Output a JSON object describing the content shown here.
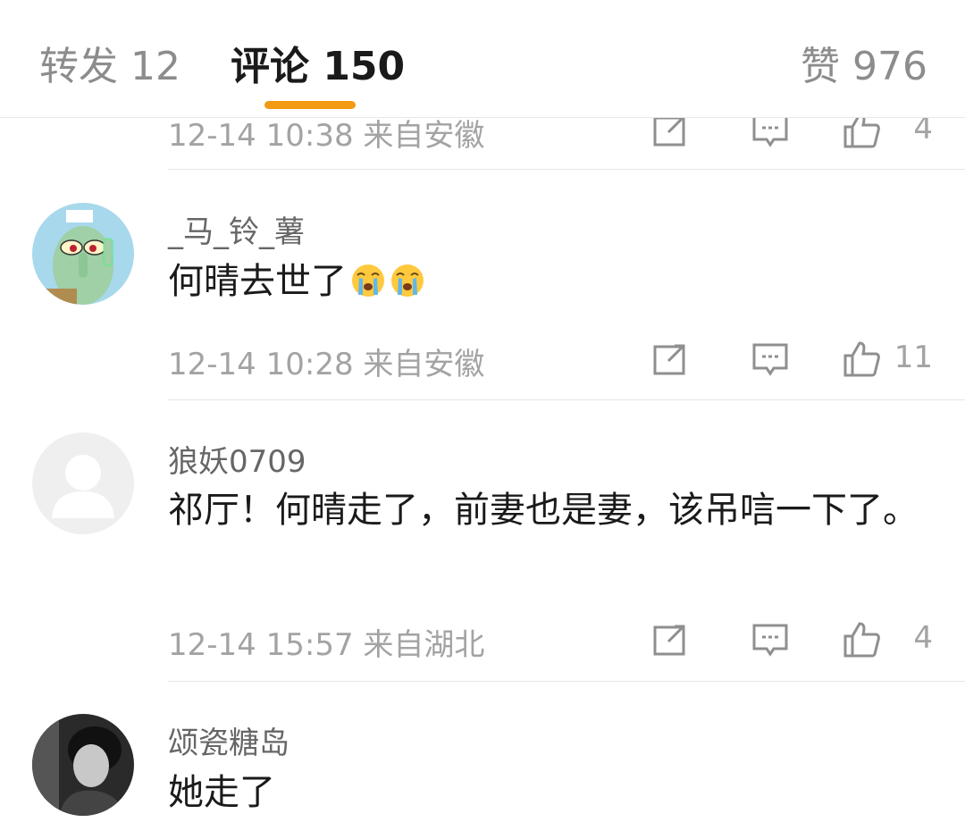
{
  "tabs": {
    "repost": "转发 12",
    "comments": "评论 150",
    "likes": "赞 976"
  },
  "colors": {
    "accent": "#f29a14",
    "muted": "#a3a3a3",
    "divider": "#e6e6e6"
  },
  "comments": [
    {
      "meta": "12-14 10:38 来自安徽",
      "like_count": "4"
    },
    {
      "username": "_马_铃_薯",
      "text": "何晴去世了",
      "emojis": [
        "crying-emoji",
        "crying-emoji"
      ],
      "meta": "12-14 10:28 来自安徽",
      "like_count": "11",
      "avatar": "cartoon-avatar"
    },
    {
      "username": "狼妖0709",
      "text": "祁厅！何晴走了，前妻也是妻，该吊唁一下了。",
      "meta": "12-14 15:57 来自湖北",
      "like_count": "4",
      "avatar": "default-avatar"
    },
    {
      "username": "颂瓷糖岛",
      "text": "她走了",
      "avatar": "photo-avatar"
    }
  ]
}
